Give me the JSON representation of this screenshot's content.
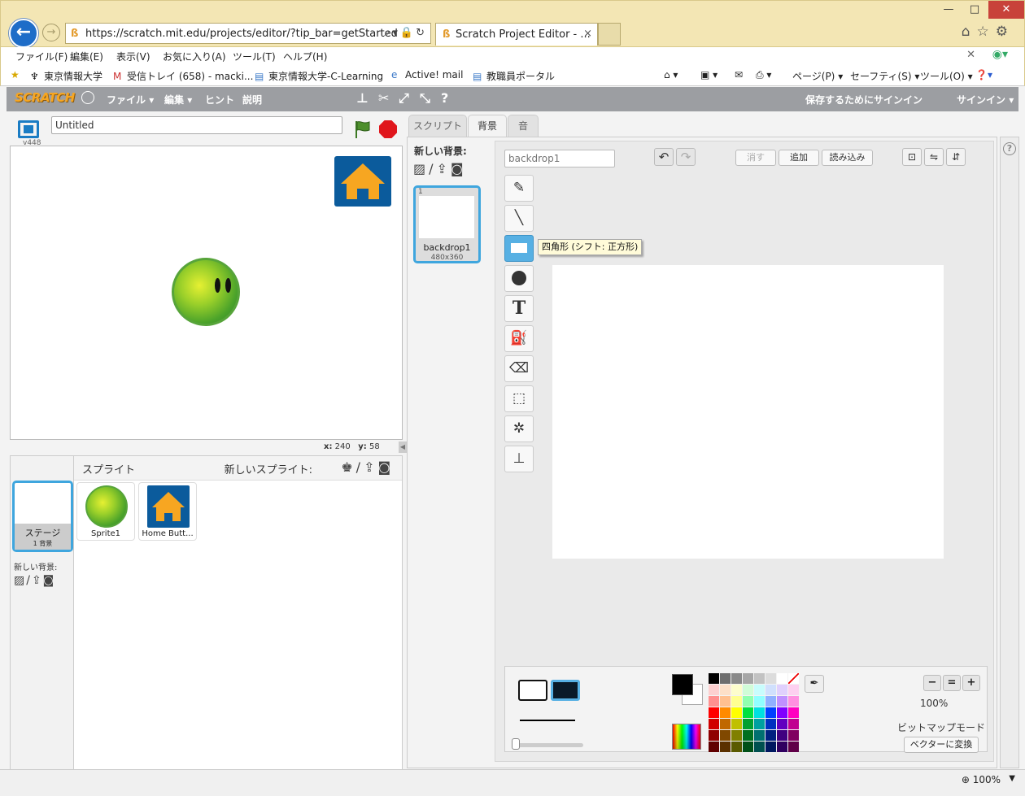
{
  "browser": {
    "url": "https://scratch.mit.edu/projects/editor/?tip_bar=getStarted",
    "tab_title": "Scratch Project Editor - ...",
    "tab_close": "×",
    "menu": [
      "ファイル(F)",
      "編集(E)",
      "表示(V)",
      "お気に入り(A)",
      "ツール(T)",
      "ヘルプ(H)"
    ],
    "favorites": [
      "東京情報大学",
      "受信トレイ (658) - macki...",
      "東京情報大学-C-Learning",
      "Active! mail",
      "教職員ポータル"
    ],
    "commands": [
      "ページ(P)",
      "セーフティ(S)",
      "ツール(O)"
    ],
    "zoom": "100%"
  },
  "scratch": {
    "logo": "SCRATCH",
    "menu": [
      "ファイル",
      "編集",
      "ヒント",
      "説明"
    ],
    "save_signin": "保存するためにサインイン",
    "signin": "サインイン",
    "version": "v448",
    "project_title": "Untitled",
    "coords": {
      "x_label": "x:",
      "x": "240",
      "y_label": "y:",
      "y": "58"
    }
  },
  "sprites": {
    "header": "スプライト",
    "new_sprite": "新しいスプライト:",
    "stage_label": "ステージ",
    "stage_sub": "1 背景",
    "new_backdrop": "新しい背景:",
    "items": [
      "Sprite1",
      "Home Butt..."
    ]
  },
  "editor": {
    "tabs": [
      "スクリプト",
      "背景",
      "音"
    ],
    "new_backdrop_label": "新しい背景:",
    "backdrop": {
      "num": "1",
      "name": "backdrop1",
      "size": "480x360"
    },
    "costume_name_placeholder": "backdrop1",
    "buttons": {
      "clear": "消す",
      "add": "追加",
      "import": "読み込み"
    },
    "tooltip": "四角形 (シフト: 正方形)",
    "zoom_pct": "100%",
    "mode": "ビットマップモード",
    "convert": "ベクターに変換"
  },
  "palette": {
    "colors": [
      "#000000",
      "#6e6e6e",
      "#8a8a8a",
      "#a6a6a6",
      "#c2c2c2",
      "#dcdcdc",
      "#ffffff",
      "#ff2222",
      "#fdd0d0",
      "#fde0c8",
      "#fdfdcc",
      "#d0fdd8",
      "#c8fdfd",
      "#d0e0fd",
      "#e0d0fd",
      "#fdd0f0",
      "#ff9090",
      "#ffc090",
      "#ffff90",
      "#90ffb0",
      "#90ffff",
      "#90b0ff",
      "#c090ff",
      "#ff90e0",
      "#ff0000",
      "#ff8a00",
      "#ffff00",
      "#00e040",
      "#00e0e0",
      "#0040ff",
      "#8000ff",
      "#ff00c0",
      "#d00000",
      "#c06800",
      "#c0c000",
      "#00a030",
      "#00a0a0",
      "#0030c0",
      "#6000c0",
      "#c00090",
      "#900000",
      "#804800",
      "#808000",
      "#007020",
      "#007070",
      "#002080",
      "#400080",
      "#800060",
      "#600000",
      "#5a3000",
      "#5a5a00",
      "#005018",
      "#005050",
      "#001860",
      "#300060",
      "#600048"
    ]
  }
}
